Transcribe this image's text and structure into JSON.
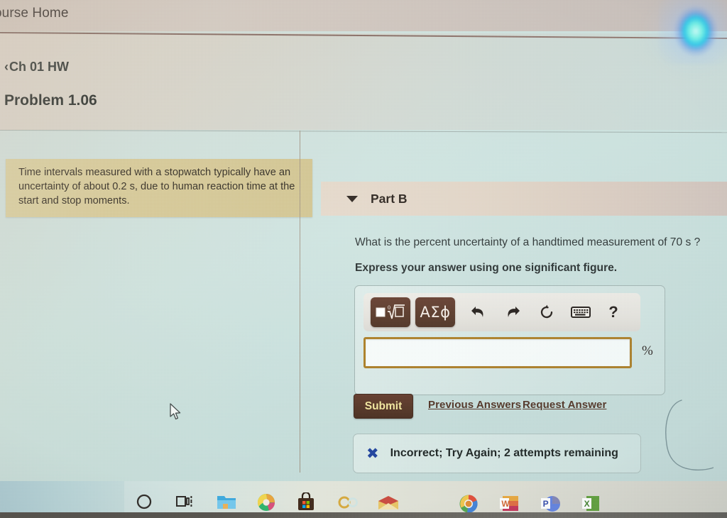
{
  "browser": {
    "top_tab_label": "ourse Home"
  },
  "header": {
    "breadcrumb_chevron": "‹",
    "breadcrumb_label": "Ch 01 HW",
    "problem_title": "Problem 1.06"
  },
  "problem": {
    "statement": "Time intervals measured with a stopwatch typically have an uncertainty of about 0.2 s, due to human reaction time at the start and stop moments."
  },
  "part": {
    "label": "Part B",
    "caret": "▼",
    "question": "What is the percent uncertainty of a handtimed measurement of 70 s ?",
    "instruction": "Express your answer using one significant figure."
  },
  "answer": {
    "value": "",
    "placeholder": "",
    "unit": "%",
    "toolbar": {
      "template_button": "□√□",
      "greek_button": "ΑΣϕ",
      "undo": "↶",
      "redo": "↷",
      "reset": "↻",
      "keyboard": "⌨",
      "help": "?"
    }
  },
  "actions": {
    "submit_label": "Submit",
    "previous_answers_label": "Previous Answers",
    "request_answer_label": "Request Answer"
  },
  "feedback": {
    "icon": "✖",
    "icon_color": "#1c3f9b",
    "message": "Incorrect; Try Again; 2 attempts remaining"
  },
  "taskbar": {
    "items": [
      {
        "name": "cortana",
        "label": "Cortana"
      },
      {
        "name": "task-view",
        "label": "Task View"
      },
      {
        "name": "file-explorer",
        "label": "File Explorer"
      },
      {
        "name": "edge",
        "label": "Microsoft Edge"
      },
      {
        "name": "microsoft-store",
        "label": "Microsoft Store"
      },
      {
        "name": "office",
        "label": "Office"
      },
      {
        "name": "mail",
        "label": "Mail"
      },
      {
        "name": "chrome",
        "label": "Google Chrome"
      },
      {
        "name": "word",
        "label": "W"
      },
      {
        "name": "powerpoint",
        "label": "P"
      },
      {
        "name": "excel",
        "label": "X"
      }
    ]
  },
  "colors": {
    "page_background": "#cbe0dc",
    "statement_background": "#d5c893",
    "accent_brown": "#51301f",
    "input_border": "#a8791f",
    "submit_text": "#f0e59a",
    "part_header_background": "#e0d3c4"
  }
}
